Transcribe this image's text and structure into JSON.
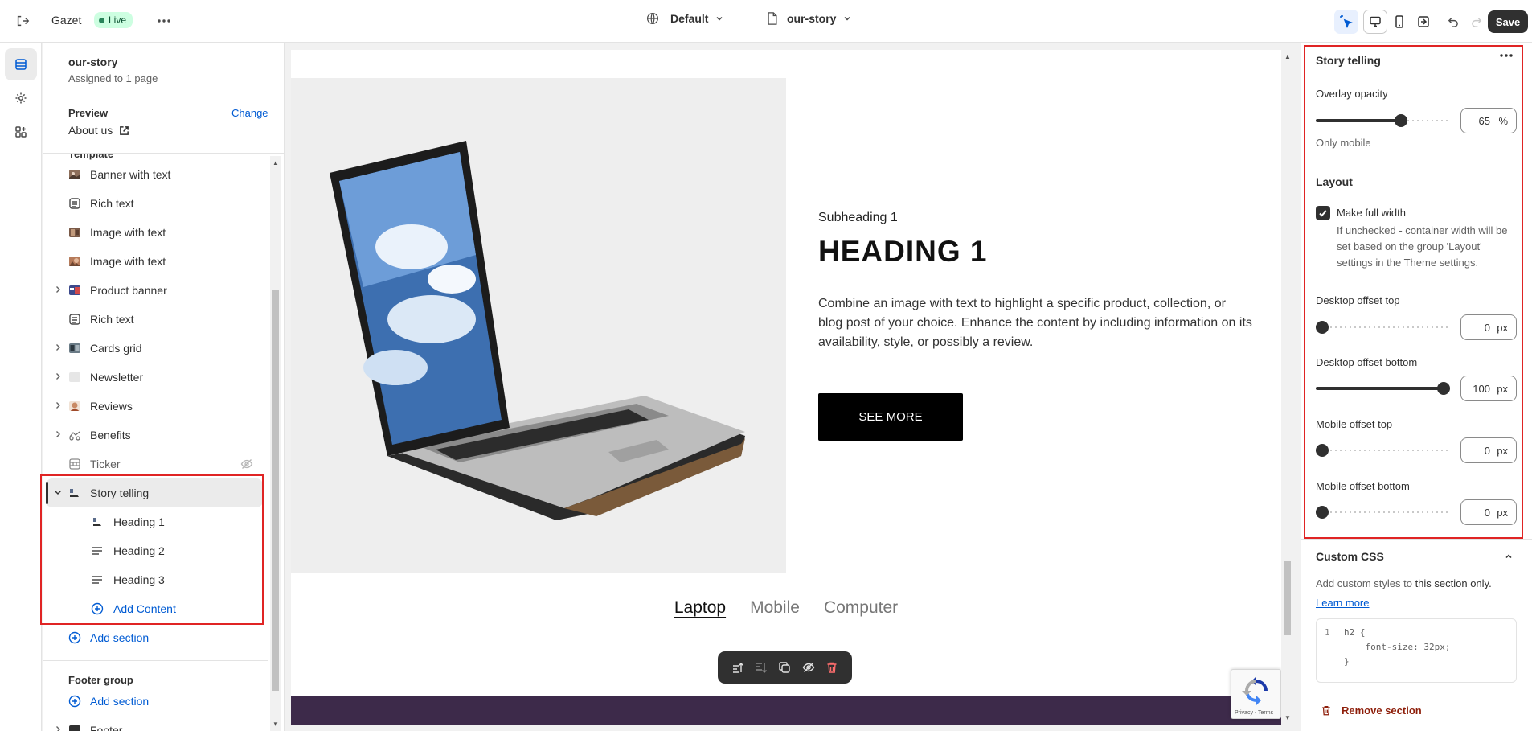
{
  "topbar": {
    "store_name": "Gazet",
    "status_badge": "Live",
    "theme_selector": "Default",
    "page_selector": "our-story",
    "save_label": "Save"
  },
  "sidebar": {
    "template_name": "our-story",
    "assigned_text": "Assigned to 1 page",
    "preview_label": "Preview",
    "change_link": "Change",
    "preview_page": "About us",
    "template_group_label": "Template",
    "sections": [
      {
        "label": "Banner with text",
        "icon": "image-thumbnail-icon"
      },
      {
        "label": "Rich text",
        "icon": "rich-text-icon"
      },
      {
        "label": "Image with text",
        "icon": "image-thumbnail-icon"
      },
      {
        "label": "Image with text",
        "icon": "image-thumbnail-icon"
      },
      {
        "label": "Product banner",
        "icon": "image-thumbnail-icon"
      },
      {
        "label": "Rich text",
        "icon": "rich-text-icon"
      },
      {
        "label": "Cards grid",
        "icon": "image-thumbnail-icon"
      },
      {
        "label": "Newsletter",
        "icon": "blank-thumbnail-icon"
      },
      {
        "label": "Reviews",
        "icon": "image-thumbnail-icon"
      },
      {
        "label": "Benefits",
        "icon": "image-thumbnail-icon"
      },
      {
        "label": "Ticker",
        "icon": "ticker-icon"
      },
      {
        "label": "Story telling",
        "icon": "image-thumbnail-icon"
      }
    ],
    "story_blocks": [
      {
        "label": "Heading 1",
        "icon": "image-thumbnail-icon"
      },
      {
        "label": "Heading 2",
        "icon": "text-lines-icon"
      },
      {
        "label": "Heading 3",
        "icon": "text-lines-icon"
      }
    ],
    "add_content": "Add Content",
    "add_section": "Add section",
    "footer_group_label": "Footer group",
    "footer_add_section": "Add section",
    "footer_cut_item": "Footer"
  },
  "preview": {
    "subheading": "Subheading 1",
    "heading": "HEADING 1",
    "body": "Combine an image with text to highlight a specific product, collection, or blog post of your choice. Enhance the content by including information on its availability, style, or possibly a review.",
    "button": "SEE MORE",
    "tabs": [
      "Laptop",
      "Mobile",
      "Computer"
    ],
    "active_tab": "Laptop",
    "recaptcha_text": "Privacy - Terms"
  },
  "settings": {
    "title": "Story telling",
    "overlay_opacity": {
      "label": "Overlay opacity",
      "value": "65",
      "unit": "%",
      "fraction": 0.65
    },
    "only_mobile": "Only mobile",
    "layout_label": "Layout",
    "full_width": {
      "label": "Make full width",
      "checked": true,
      "help": "If unchecked - container width will be set based on the group 'Layout' settings in the Theme settings."
    },
    "desktop_offset_top": {
      "label": "Desktop offset top",
      "value": "0",
      "unit": "px",
      "fraction": 0
    },
    "desktop_offset_bottom": {
      "label": "Desktop offset bottom",
      "value": "100",
      "unit": "px",
      "fraction": 1
    },
    "mobile_offset_top": {
      "label": "Mobile offset top",
      "value": "0",
      "unit": "px",
      "fraction": 0
    },
    "mobile_offset_bottom": {
      "label": "Mobile offset bottom",
      "value": "0",
      "unit": "px",
      "fraction": 0
    },
    "custom_css": {
      "title": "Custom CSS",
      "description_prefix": "Add custom styles to ",
      "description_bold": "this section only.",
      "learn_more": "Learn more",
      "code_lines": [
        {
          "n": "1",
          "code": "h2 {"
        },
        {
          "n": "",
          "code": "    font-size: 32px;"
        },
        {
          "n": "",
          "code": "}"
        }
      ]
    },
    "remove_section": "Remove section"
  },
  "colors": {
    "accent": "#005bd3",
    "highlight_box": "#e02424",
    "live_badge_bg": "#cdfee1",
    "dark": "#303030",
    "footer_band": "#3d2a4a"
  }
}
